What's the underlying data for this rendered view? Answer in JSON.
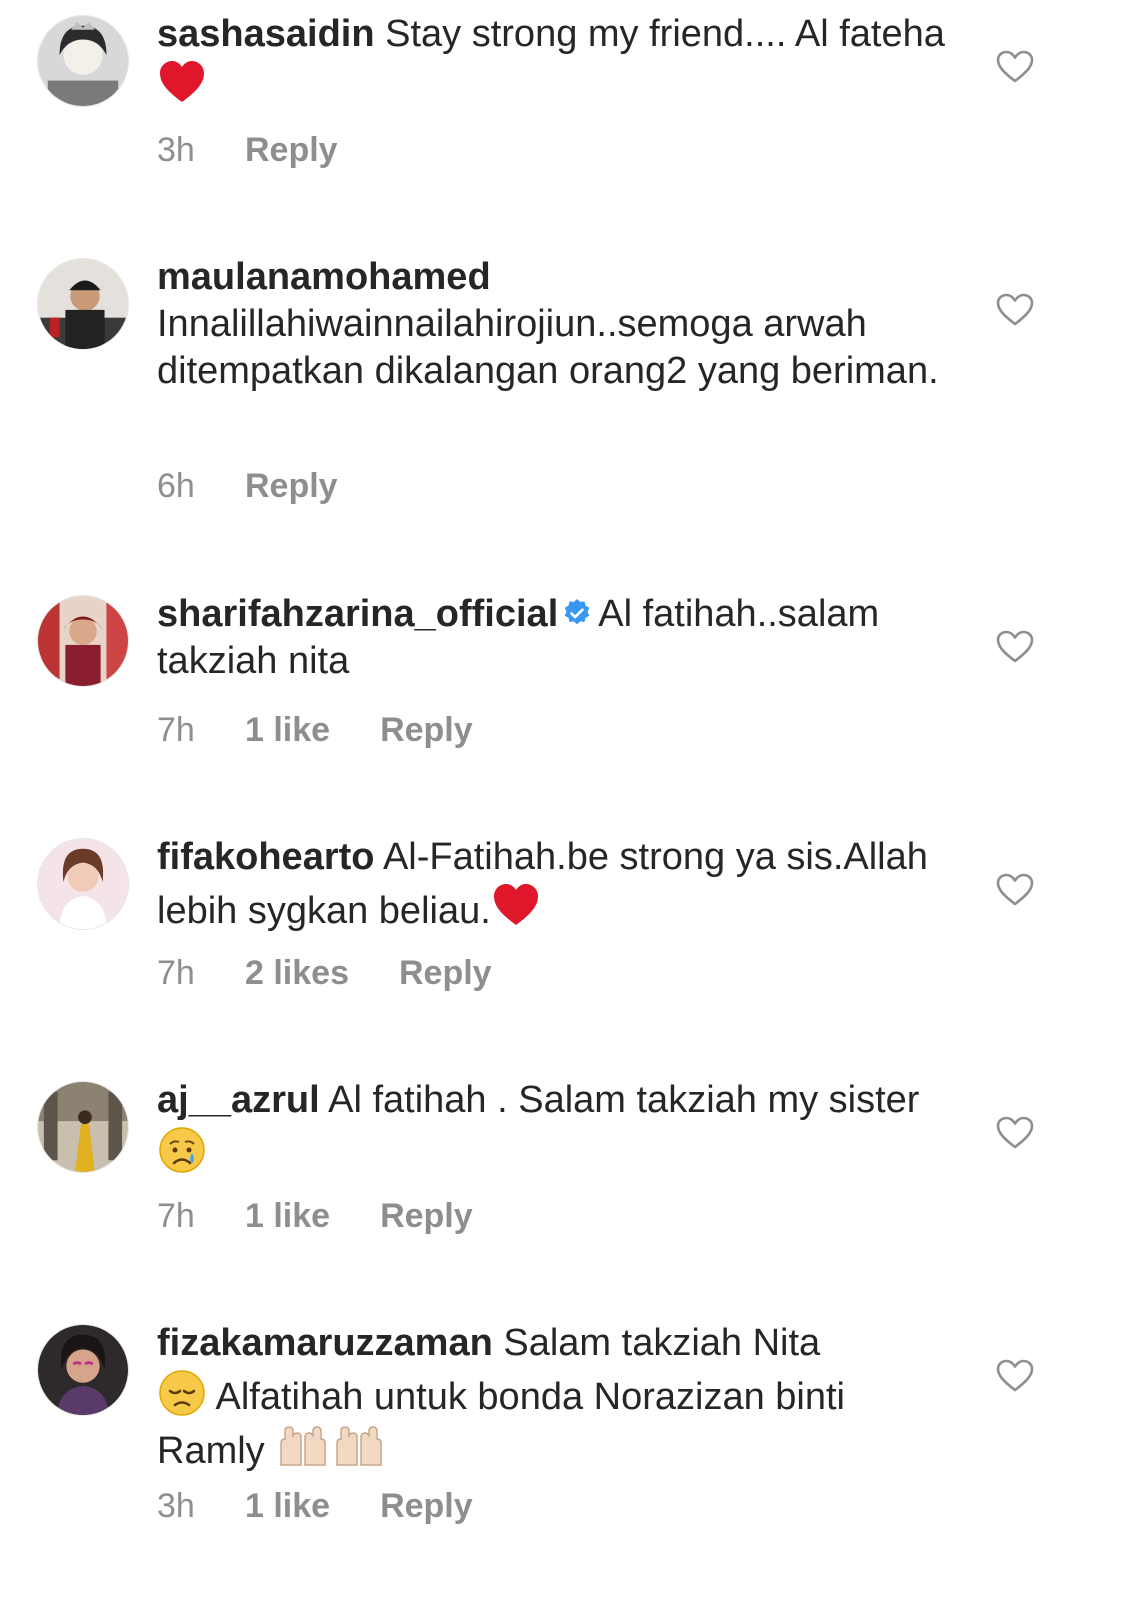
{
  "colors": {
    "text": "#262626",
    "meta": "#8e8e8e",
    "verified": "#3897f0",
    "heart_emoji": "#e0162b"
  },
  "comments": [
    {
      "username": "sashasaidin",
      "text": "Stay strong my friend.... Al fateha",
      "emoji": "red-heart",
      "time": "3h",
      "likes": "",
      "reply": "Reply",
      "verified": false
    },
    {
      "username": "maulanamohamed",
      "text": "Innalillahiwainnailahirojiun..semoga arwah ditempatkan dikalangan orang2 yang beriman.",
      "emoji": "",
      "time": "6h",
      "likes": "",
      "reply": "Reply",
      "verified": false
    },
    {
      "username": "sharifahzarina_official",
      "text": "Al fatihah..salam takziah nita",
      "emoji": "",
      "time": "7h",
      "likes": "1 like",
      "reply": "Reply",
      "verified": true
    },
    {
      "username": "fifakohearto",
      "text": "Al-Fatihah.be strong ya sis.Allah lebih sygkan beliau.",
      "emoji": "red-heart",
      "time": "7h",
      "likes": "2 likes",
      "reply": "Reply",
      "verified": false
    },
    {
      "username": "aj__azrul",
      "text": "Al fatihah . Salam takziah my sister",
      "emoji": "crying-face",
      "time": "7h",
      "likes": "1 like",
      "reply": "Reply",
      "verified": false
    },
    {
      "username": "fizakamaruzzaman",
      "text_before": "Salam takziah Nita",
      "text_after": "Alfatihah untuk bonda Norazizan binti Ramly",
      "emoji": "disappointed-face",
      "trailing_emoji": "raising-hands",
      "time": "3h",
      "likes": "1 like",
      "reply": "Reply",
      "verified": false
    }
  ]
}
